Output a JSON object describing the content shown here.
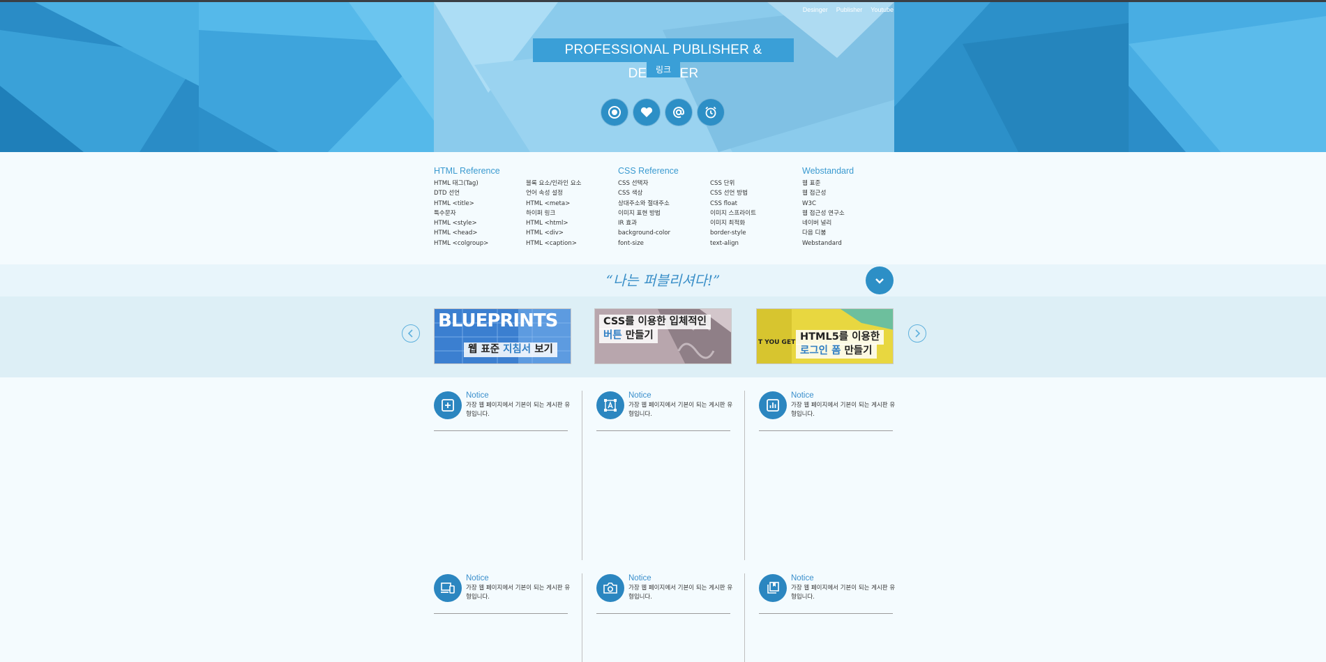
{
  "header": {
    "nav": [
      "Desinger",
      "Publisher",
      "Youtube"
    ],
    "title": "PROFESSIONAL PUBLISHER & DESIGNER",
    "link_label": "링크",
    "icons": [
      "record-icon",
      "heart-icon",
      "at-icon",
      "alarm-clock-icon"
    ]
  },
  "references": [
    {
      "heading": "HTML Reference",
      "columns": [
        [
          "HTML 태그(Tag)",
          "DTD 선언",
          "HTML <title>",
          "특수문자",
          "HTML <style>",
          "HTML <head>",
          "HTML <colgroup>"
        ],
        [
          "블록 요소/인라인 요소",
          "언어 속성 설정",
          "HTML <meta>",
          "하이퍼 링크",
          "HTML <html>",
          "HTML <div>",
          "HTML <caption>"
        ]
      ]
    },
    {
      "heading": "CSS Reference",
      "columns": [
        [
          "CSS 선택자",
          "CSS 색상",
          "상대주소와 절대주소",
          "이미지 표현 방법",
          "IR 효과",
          "background-color",
          "font-size"
        ],
        [
          "CSS 단위",
          "CSS 선언 방법",
          "CSS float",
          "이미지 스프라이트",
          "이미지 최적화",
          "border-style",
          "text-align"
        ]
      ]
    },
    {
      "heading": "Webstandard",
      "columns": [
        [
          "웹 표준",
          "웹 접근성",
          "W3C",
          "웹 접근성 연구소",
          "네이버 널리",
          "다음 디붐",
          "Webstandard"
        ]
      ]
    }
  ],
  "slogan": "“나는 퍼블리셔다!”",
  "slides": [
    {
      "banner": "BLUEPRINTS",
      "line1_pre": "웹 표준 ",
      "line1_hl": "지침서",
      "line1_post": " 보기",
      "line2_pre": "",
      "line2_hl": "",
      "line2_post": ""
    },
    {
      "banner": "",
      "line1_pre": "CSS를 이용한 입체적인",
      "line1_hl": "",
      "line1_post": "",
      "line2_pre": "",
      "line2_hl": "버튼",
      "line2_post": " 만들기"
    },
    {
      "banner": "T YOU GET",
      "line1_pre": "HTML5를 이용한",
      "line1_hl": "",
      "line1_post": "",
      "line2_pre": "",
      "line2_hl": "로그인 폼",
      "line2_post": " 만들기"
    }
  ],
  "notices": [
    {
      "title": "Notice",
      "desc": "가장 웹 페이지에서 기본이 되는 게시판 유형입니다.",
      "icon": "plus-box-icon"
    },
    {
      "title": "Notice",
      "desc": "가장 웹 페이지에서 기본이 되는 게시판 유형입니다.",
      "icon": "vector-a-icon"
    },
    {
      "title": "Notice",
      "desc": "가장 웹 페이지에서 기본이 되는 게시판 유형입니다.",
      "icon": "bar-chart-icon"
    },
    {
      "title": "Notice",
      "desc": "가장 웹 페이지에서 기본이 되는 게시판 유형입니다.",
      "icon": "devices-icon"
    },
    {
      "title": "Notice",
      "desc": "가장 웹 페이지에서 기본이 되는 게시판 유형입니다.",
      "icon": "camera-rotate-icon"
    },
    {
      "title": "Notice",
      "desc": "가장 웹 페이지에서 기본이 되는 게시판 유형입니다.",
      "icon": "library-icon"
    }
  ],
  "colors": {
    "accent": "#2b86c0",
    "hero": "#3da7de",
    "page": "#f4fbfe"
  }
}
